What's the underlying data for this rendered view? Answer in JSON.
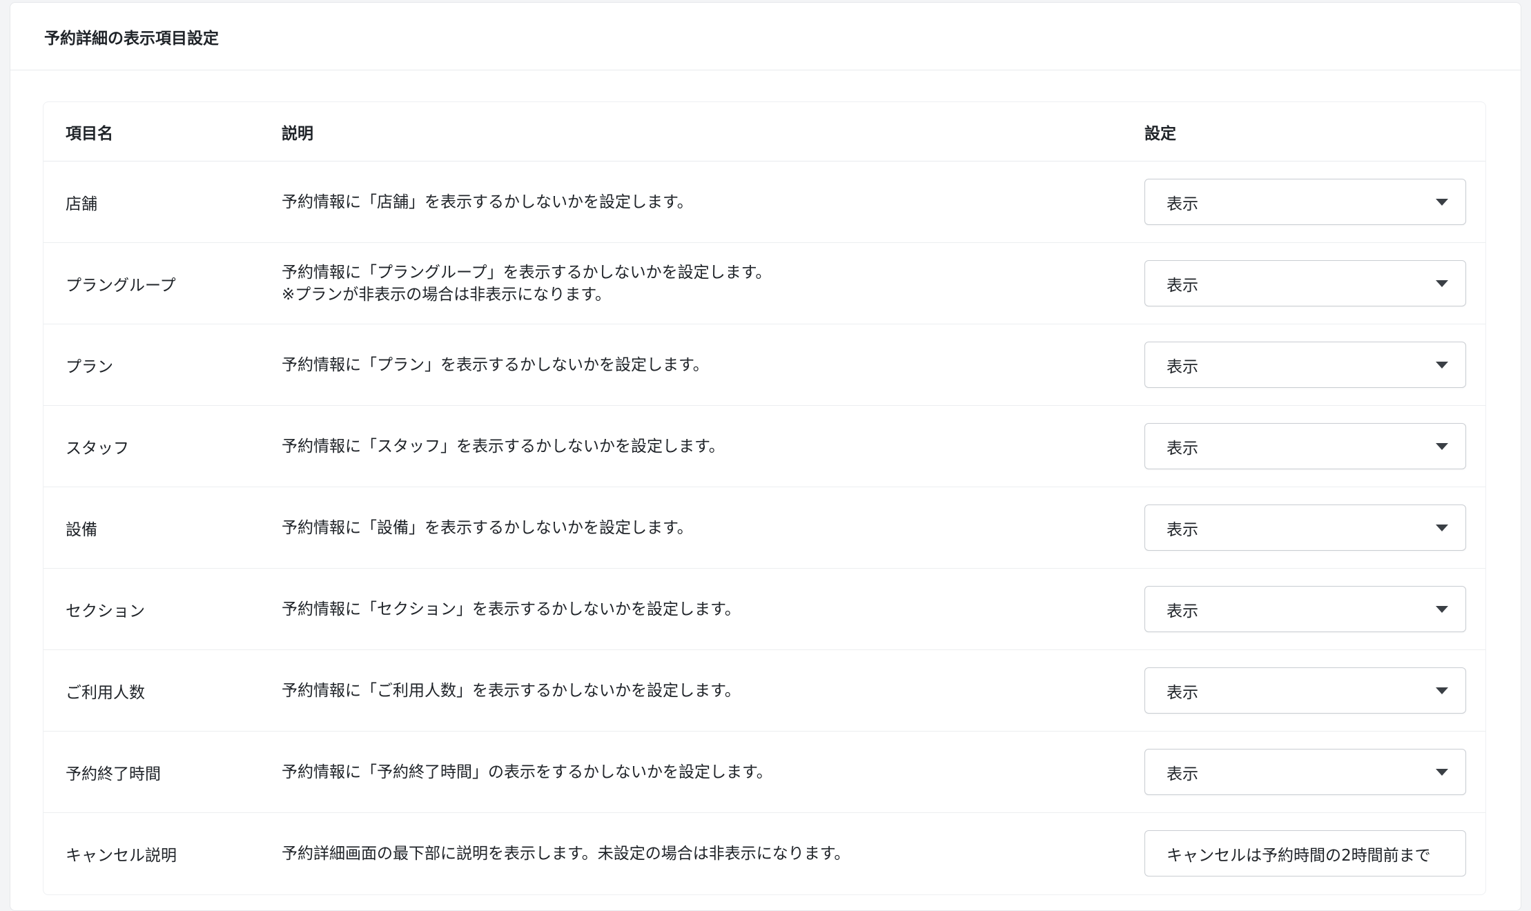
{
  "panel": {
    "title": "予約詳細の表示項目設定"
  },
  "table": {
    "headers": {
      "name": "項目名",
      "description": "説明",
      "setting": "設定"
    },
    "rows": [
      {
        "name": "店舗",
        "description": "予約情報に「店舗」を表示するかしないかを設定します。",
        "note": "",
        "value": "表示"
      },
      {
        "name": "プラングループ",
        "description": "予約情報に「プラングループ」を表示するかしないかを設定します。",
        "note": "※プランが非表示の場合は非表示になります。",
        "value": "表示"
      },
      {
        "name": "プラン",
        "description": "予約情報に「プラン」を表示するかしないかを設定します。",
        "note": "",
        "value": "表示"
      },
      {
        "name": "スタッフ",
        "description": "予約情報に「スタッフ」を表示するかしないかを設定します。",
        "note": "",
        "value": "表示"
      },
      {
        "name": "設備",
        "description": "予約情報に「設備」を表示するかしないかを設定します。",
        "note": "",
        "value": "表示"
      },
      {
        "name": "セクション",
        "description": "予約情報に「セクション」を表示するかしないかを設定します。",
        "note": "",
        "value": "表示"
      },
      {
        "name": "ご利用人数",
        "description": "予約情報に「ご利用人数」を表示するかしないかを設定します。",
        "note": "",
        "value": "表示"
      },
      {
        "name": "予約終了時間",
        "description": "予約情報に「予約終了時間」の表示をするかしないかを設定します。",
        "note": "",
        "value": "表示"
      }
    ],
    "cancel_row": {
      "name": "キャンセル説明",
      "description": "予約詳細画面の最下部に説明を表示します。未設定の場合は非表示になります。",
      "input_value": "キャンセルは予約時間の2時間前まで"
    }
  }
}
